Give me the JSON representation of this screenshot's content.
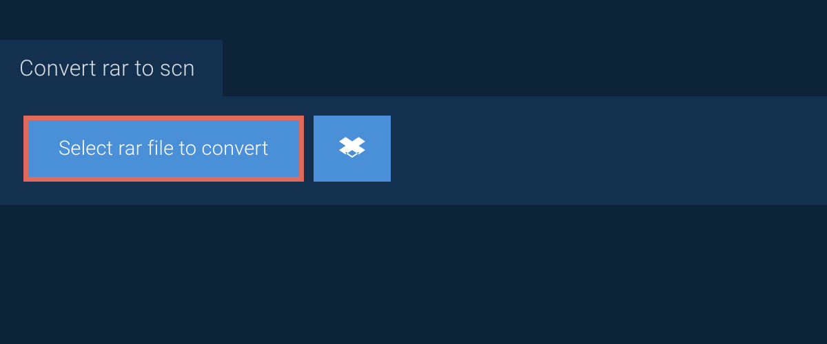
{
  "header": {
    "title": "Convert rar to scn"
  },
  "actions": {
    "select_file_label": "Select rar file to convert"
  },
  "colors": {
    "page_bg": "#0d2438",
    "panel_bg": "#13314f",
    "button_bg": "#4a90d9",
    "highlight_border": "#e06a5b",
    "text_light": "#d9dde0",
    "text_white": "#ffffff"
  }
}
